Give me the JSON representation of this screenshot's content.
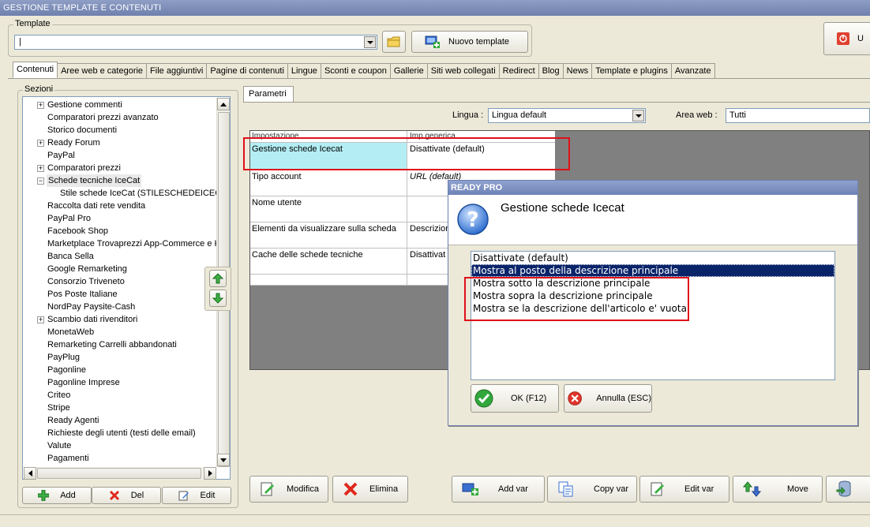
{
  "window": {
    "title": "GESTIONE TEMPLATE E CONTENUTI"
  },
  "template": {
    "label": "Template",
    "value": "|",
    "new_button": "Nuovo template",
    "exit_button": "U"
  },
  "tabs": [
    {
      "label": "Contenuti",
      "active": true
    },
    {
      "label": "Aree web e categorie"
    },
    {
      "label": "File aggiuntivi"
    },
    {
      "label": "Pagine di contenuti"
    },
    {
      "label": "Lingue"
    },
    {
      "label": "Sconti e coupon"
    },
    {
      "label": "Gallerie"
    },
    {
      "label": "Siti web collegati"
    },
    {
      "label": "Redirect"
    },
    {
      "label": "Blog"
    },
    {
      "label": "News"
    },
    {
      "label": "Template e plugins"
    },
    {
      "label": "Avanzate"
    }
  ],
  "sezioni": {
    "label": "Sezioni",
    "items": [
      {
        "label": "Gestione commenti",
        "expand": "+"
      },
      {
        "label": "Comparatori prezzi avanzato"
      },
      {
        "label": "Storico documenti"
      },
      {
        "label": "Ready Forum",
        "expand": "+"
      },
      {
        "label": "PayPal"
      },
      {
        "label": "Comparatori prezzi",
        "expand": "+"
      },
      {
        "label": "Schede tecniche IceCat",
        "expand": "−",
        "selected": true
      },
      {
        "label": "Stile schede IceCat (STILESCHEDEICECAT",
        "child": true
      },
      {
        "label": "Raccolta dati rete vendita"
      },
      {
        "label": "PayPal Pro"
      },
      {
        "label": "Facebook Shop"
      },
      {
        "label": "Marketplace Trovaprezzi App-Commerce e Ki"
      },
      {
        "label": "Banca Sella"
      },
      {
        "label": "Google Remarketing"
      },
      {
        "label": "Consorzio Triveneto"
      },
      {
        "label": "Pos Poste Italiane"
      },
      {
        "label": "NordPay Paysite-Cash"
      },
      {
        "label": "Scambio dati rivenditori",
        "expand": "+"
      },
      {
        "label": "MonetaWeb"
      },
      {
        "label": "Remarketing Carrelli abbandonati"
      },
      {
        "label": "PayPlug"
      },
      {
        "label": "Pagonline"
      },
      {
        "label": "Pagonline Imprese"
      },
      {
        "label": "Criteo"
      },
      {
        "label": "Stripe"
      },
      {
        "label": "Ready Agenti"
      },
      {
        "label": "Richieste degli utenti (testi delle email)"
      },
      {
        "label": "Valute"
      },
      {
        "label": "Pagamenti"
      }
    ],
    "buttons": {
      "add": "Add",
      "del": "Del",
      "edit": "Edit"
    }
  },
  "parametri": {
    "tab": "Parametri",
    "lingua_label": "Lingua :",
    "lingua_value": "Lingua default",
    "area_label": "Area web :",
    "area_value": "Tutti",
    "grid": {
      "header": [
        "Impostazione",
        "Imp.generica"
      ],
      "rows": [
        {
          "name": "Gestione schede Icecat",
          "value": "Disattivate (default)",
          "selected": true
        },
        {
          "name": "Tipo account",
          "value": "URL (default)",
          "italic": true
        },
        {
          "name": "Nome utente",
          "value": ""
        },
        {
          "name": "Elementi da visualizzare sulla scheda",
          "value": "Descrizion"
        },
        {
          "name": "Cache delle schede tecniche",
          "value": "Disattivat"
        },
        {
          "name": "",
          "value": ""
        }
      ]
    }
  },
  "dialog": {
    "title": "READY PRO",
    "heading": "Gestione schede Icecat",
    "options": [
      {
        "label": "Disattivate (default)"
      },
      {
        "label": "Mostra al posto della descrizione principale",
        "selected": true
      },
      {
        "label": "Mostra sotto la descrizione principale"
      },
      {
        "label": "Mostra sopra la descrizione principale"
      },
      {
        "label": "Mostra se la descrizione dell'articolo e' vuota"
      }
    ],
    "ok": "OK (F12)",
    "cancel": "Annulla (ESC)"
  },
  "toolbar": {
    "modifica": "Modifica",
    "elimina": "Elimina",
    "add_var": "Add var",
    "copy_var": "Copy var",
    "edit_var": "Edit var",
    "move": "Move"
  },
  "colors": {
    "title_bar": "#7b8bb8",
    "highlight_cyan": "#b4eef4",
    "selection_navy": "#0a246a",
    "annotation_red": "#e0101a"
  }
}
